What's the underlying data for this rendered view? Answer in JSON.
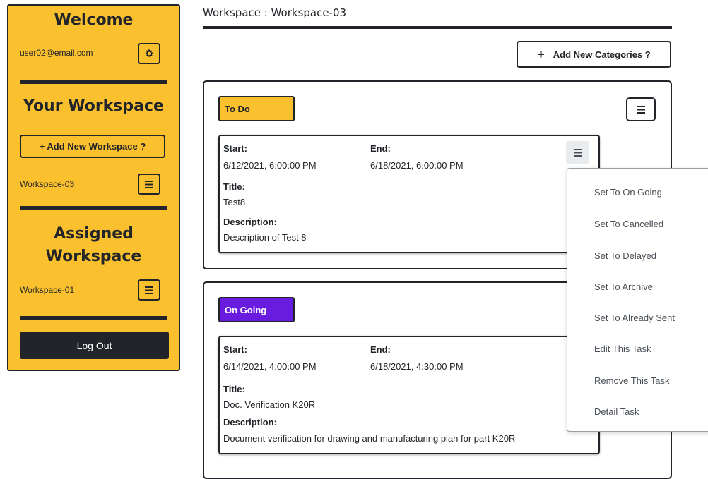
{
  "sidebar": {
    "welcome": "Welcome",
    "user_email": "user02@email.com",
    "your_workspace_heading": "Your Workspace",
    "add_workspace_label": "+ Add New Workspace ?",
    "own_workspaces": [
      {
        "name": "Workspace-03"
      }
    ],
    "assigned_heading_line1": "Assigned",
    "assigned_heading_line2": "Workspace",
    "assigned_workspaces": [
      {
        "name": "Workspace-01"
      }
    ],
    "logout_label": "Log Out"
  },
  "main": {
    "workspace_title": "Workspace : Workspace-03",
    "add_category_label": "Add New Categories ?",
    "categories": [
      {
        "name": "To Do",
        "color": "#fbc02d",
        "text_color": "#212529",
        "tasks": [
          {
            "start_label": "Start:",
            "start": "6/12/2021, 6:00:00 PM",
            "end_label": "End:",
            "end": "6/18/2021, 6:00:00 PM",
            "title_label": "Title:",
            "title": "Test8",
            "description_label": "Description:",
            "description": "Description of Test 8"
          }
        ]
      },
      {
        "name": "On Going",
        "color": "#6a1be0",
        "text_color": "#ffffff",
        "tasks": [
          {
            "start_label": "Start:",
            "start": "6/14/2021, 4:00:00 PM",
            "end_label": "End:",
            "end": "6/18/2021, 4:30:00 PM",
            "title_label": "Title:",
            "title": "Doc. Verification K20R",
            "description_label": "Description:",
            "description": "Document verification for drawing and manufacturing plan for part K20R"
          }
        ]
      }
    ]
  },
  "task_menu": {
    "items": [
      "Set To On Going",
      "Set To Cancelled",
      "Set To Delayed",
      "Set To Archive",
      "Set To Already Sent",
      "Edit This Task",
      "Remove This Task",
      "Detail Task"
    ]
  },
  "colors": {
    "accent": "#fbc02d",
    "dark": "#212529",
    "ongoing": "#6a1be0"
  },
  "icons": {
    "settings": "gear-icon",
    "menu": "hamburger-icon",
    "add": "plus-icon"
  }
}
